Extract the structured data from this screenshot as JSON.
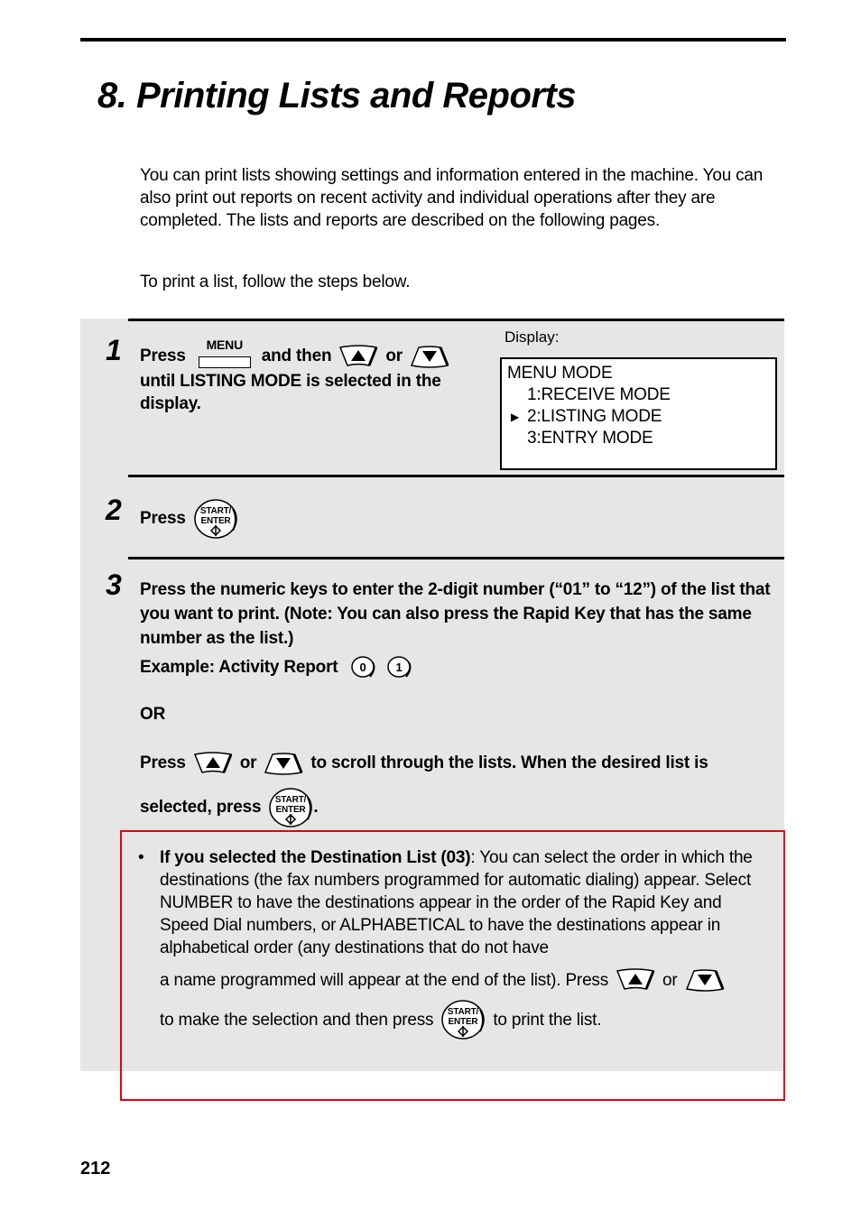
{
  "page": {
    "title": "8.  Printing Lists and Reports",
    "page_number": "212"
  },
  "intro": {
    "paragraph_1": "You can print lists showing settings and information entered in the machine. You can also print out reports on recent activity and individual operations after they are completed. The lists and reports are described on the following pages.",
    "paragraph_2": "To print a list, follow the steps below."
  },
  "keys": {
    "menu_label": "MENU",
    "start_enter_line1": "START/",
    "start_enter_line2": "ENTER",
    "num_0": "0",
    "num_1": "1"
  },
  "steps": [
    {
      "number": "1",
      "press": "Press",
      "and_then": "and then",
      "or": "or",
      "rest": "until LISTING MODE is selected in the display."
    },
    {
      "number": "2",
      "press": "Press"
    },
    {
      "number": "3",
      "paragraph": "Press the numeric keys to enter the 2-digit number (“01” to “12”) of the list that you want to print. (Note: You can also press the Rapid Key that has the same number as the list.)",
      "example": "Example: Activity Report",
      "or_label": "OR",
      "press": "Press",
      "or": "or",
      "scroll_text": "to scroll through the lists. When the desired list is",
      "selected_press": "selected, press",
      "period": "."
    }
  ],
  "display": {
    "label": "Display:",
    "lines": [
      "MENU MODE",
      "1:RECEIVE MODE",
      "2:LISTING MODE",
      "3:ENTRY MODE"
    ],
    "selected_index": 2
  },
  "note": {
    "bullet": "•",
    "bold_lead": "If you selected the Destination List (03)",
    "body": ": You can select the order in which the destinations (the fax numbers programmed for automatic dialing) appear. Select NUMBER to have the destinations appear in the order of the Rapid Key and Speed Dial numbers, or ALPHABETICAL to have the destinations appear in alphabetical order (any destinations that do not have",
    "press_line": "a name programmed will appear at the end of the list). Press",
    "or": "or",
    "final_before": "to make the selection and then press",
    "final_after": "to print the list."
  },
  "colors": {
    "panel_bg": "#e6e6e6",
    "highlight_border": "#e8000d"
  }
}
